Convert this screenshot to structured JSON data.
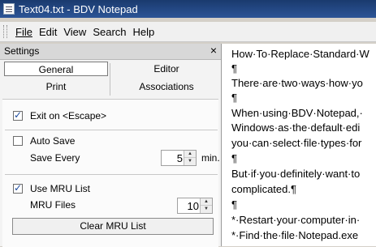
{
  "window": {
    "title": "Text04.txt - BDV Notepad"
  },
  "menu": {
    "items": [
      "File",
      "Edit",
      "View",
      "Search",
      "Help"
    ]
  },
  "settings": {
    "title": "Settings",
    "close": "×",
    "tabs": [
      "General",
      "Editor",
      "Print",
      "Associations"
    ],
    "exit_on_escape": {
      "label": "Exit on <Escape>",
      "checked": true
    },
    "auto_save": {
      "label": "Auto Save",
      "checked": false
    },
    "save_every": {
      "label": "Save Every",
      "value": "5",
      "unit": "min."
    },
    "use_mru": {
      "label": "Use MRU List",
      "checked": true
    },
    "mru_files": {
      "label": "MRU Files",
      "value": "10"
    },
    "clear_mru": "Clear MRU List"
  },
  "editor": {
    "lines": [
      "How·To·Replace·Standard·W",
      "¶",
      "There·are·two·ways·how·yo",
      "¶",
      "When·using·BDV·Notepad,·",
      "Windows·as·the·default·edi",
      "you·can·select·file·types·for",
      "¶",
      "But·if·you·definitely·want·to",
      "complicated.¶",
      "¶",
      "*·Restart·your·computer·in·",
      "*·Find·the·file·Notepad.exe"
    ]
  }
}
